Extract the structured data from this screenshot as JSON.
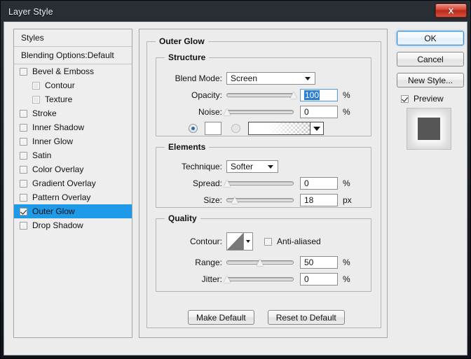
{
  "window": {
    "title": "Layer Style",
    "close_label": "x"
  },
  "styles_panel": {
    "header": "Styles",
    "blending_options": "Blending Options:Default",
    "items": [
      {
        "label": "Bevel & Emboss",
        "checked": false,
        "indent": false,
        "selected": false
      },
      {
        "label": "Contour",
        "checked": false,
        "indent": true,
        "selected": false
      },
      {
        "label": "Texture",
        "checked": false,
        "indent": true,
        "selected": false
      },
      {
        "label": "Stroke",
        "checked": false,
        "indent": false,
        "selected": false
      },
      {
        "label": "Inner Shadow",
        "checked": false,
        "indent": false,
        "selected": false
      },
      {
        "label": "Inner Glow",
        "checked": false,
        "indent": false,
        "selected": false
      },
      {
        "label": "Satin",
        "checked": false,
        "indent": false,
        "selected": false
      },
      {
        "label": "Color Overlay",
        "checked": false,
        "indent": false,
        "selected": false
      },
      {
        "label": "Gradient Overlay",
        "checked": false,
        "indent": false,
        "selected": false
      },
      {
        "label": "Pattern Overlay",
        "checked": false,
        "indent": false,
        "selected": false
      },
      {
        "label": "Outer Glow",
        "checked": true,
        "indent": false,
        "selected": true
      },
      {
        "label": "Drop Shadow",
        "checked": false,
        "indent": false,
        "selected": false
      }
    ]
  },
  "options": {
    "title": "Outer Glow",
    "structure": {
      "legend": "Structure",
      "blend_mode_label": "Blend Mode:",
      "blend_mode_value": "Screen",
      "opacity_label": "Opacity:",
      "opacity_value": "100",
      "opacity_unit": "%",
      "noise_label": "Noise:",
      "noise_value": "0",
      "noise_unit": "%",
      "fill_type": "color",
      "color_hex": "#ffffff"
    },
    "elements": {
      "legend": "Elements",
      "technique_label": "Technique:",
      "technique_value": "Softer",
      "spread_label": "Spread:",
      "spread_value": "0",
      "spread_unit": "%",
      "size_label": "Size:",
      "size_value": "18",
      "size_unit": "px"
    },
    "quality": {
      "legend": "Quality",
      "contour_label": "Contour:",
      "anti_aliased_label": "Anti-aliased",
      "anti_aliased_checked": false,
      "range_label": "Range:",
      "range_value": "50",
      "range_unit": "%",
      "jitter_label": "Jitter:",
      "jitter_value": "0",
      "jitter_unit": "%"
    },
    "make_default_label": "Make Default",
    "reset_default_label": "Reset to Default"
  },
  "right_panel": {
    "ok_label": "OK",
    "cancel_label": "Cancel",
    "new_style_label": "New Style...",
    "preview_label": "Preview",
    "preview_checked": true
  },
  "colors": {
    "selection_blue": "#1e9ae8",
    "text_selection": "#2a7fd4",
    "close_red": "#d94a38",
    "accent_focus": "#3c8fd0"
  }
}
